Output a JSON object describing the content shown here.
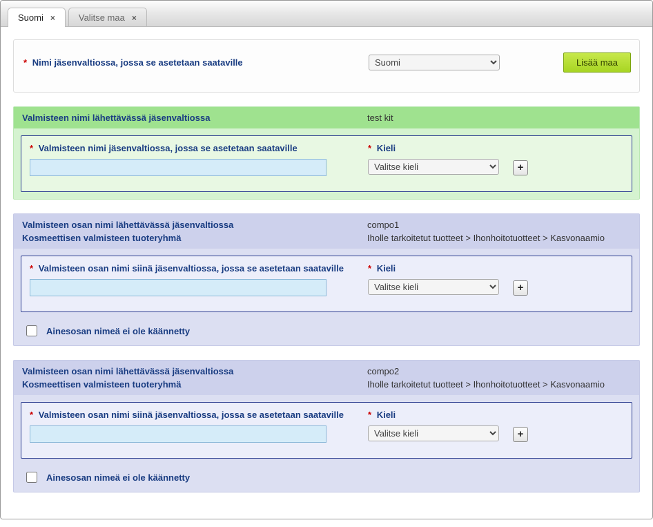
{
  "tabs": [
    {
      "label": "Suomi",
      "active": true
    },
    {
      "label": "Valitse maa",
      "active": false
    }
  ],
  "top": {
    "label": "Nimi jäsenvaltiossa, jossa se asetetaan saataville",
    "country_options": [
      "Suomi"
    ],
    "country_value": "Suomi",
    "add_btn": "Lisää maa"
  },
  "lang_label": "Kieli",
  "lang_placeholder": "Valitse kieli",
  "section_green": {
    "header_left": "Valmisteen nimi lähettävässä jäsenvaltiossa",
    "header_right": "test kit",
    "inner_label": "Valmisteen nimi jäsenvaltiossa, jossa se asetetaan saataville"
  },
  "component_labels": {
    "name_sender": "Valmisteen osan nimi lähettävässä jäsenvaltiossa",
    "product_group": "Kosmeettisen valmisteen tuoteryhmä",
    "inner_label": "Valmisteen osan nimi siinä jäsenvaltiossa, jossa se asetetaan saataville",
    "checkbox": "Ainesosan nimeä ei ole käännetty"
  },
  "components": [
    {
      "name": "compo1",
      "group": "Iholle tarkoitetut tuotteet > Ihonhoitotuotteet > Kasvonaamio"
    },
    {
      "name": "compo2",
      "group": "Iholle tarkoitetut tuotteet > Ihonhoitotuotteet > Kasvonaamio"
    }
  ]
}
